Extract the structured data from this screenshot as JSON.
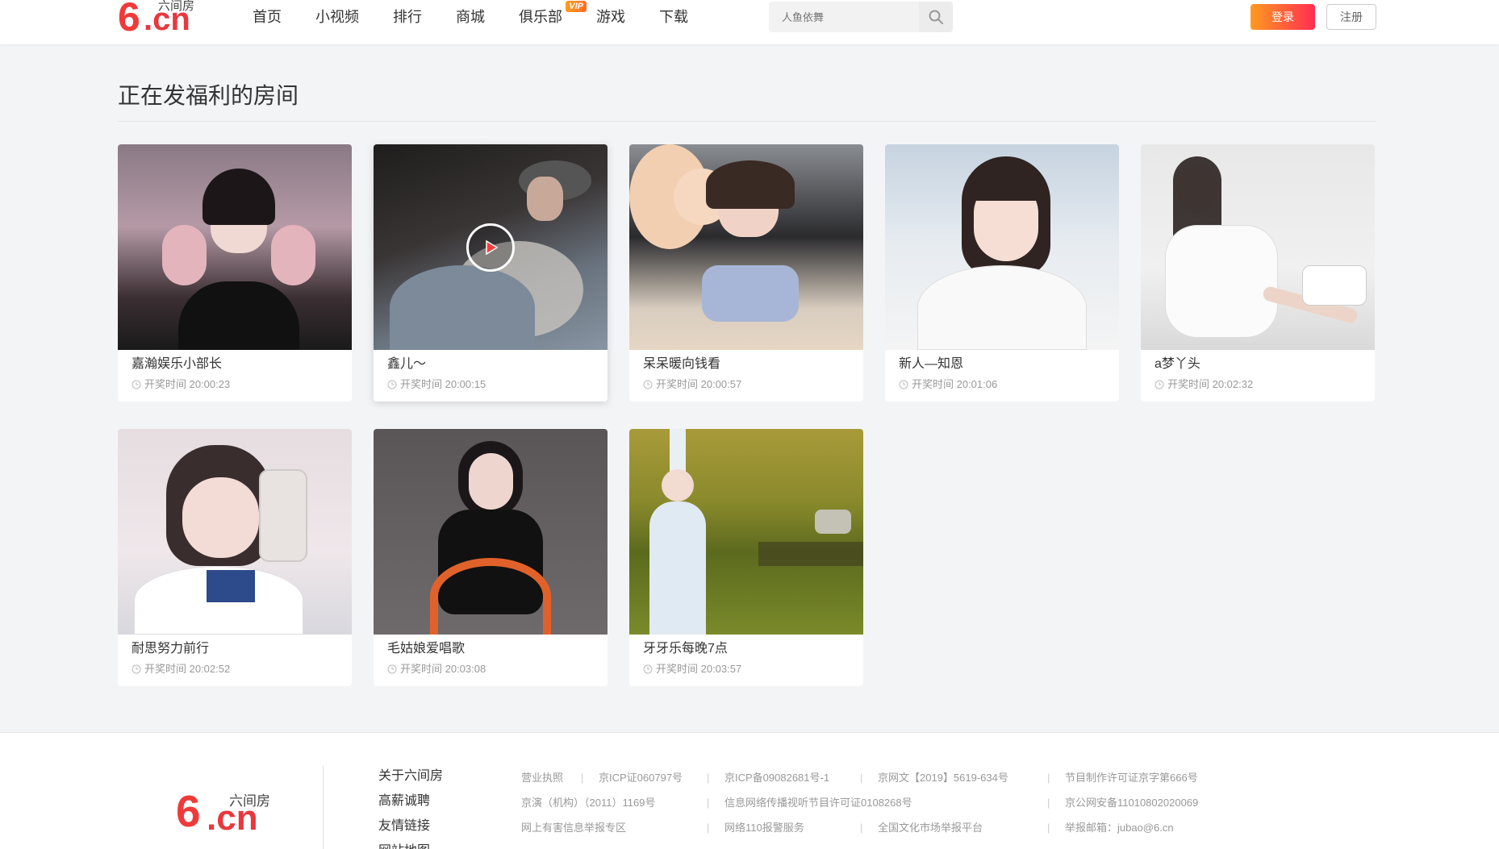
{
  "header": {
    "logo_text": "6.cn",
    "logo_six": "6",
    "logo_cn": ".cn",
    "logo_sub": "六间房",
    "nav": [
      "首页",
      "小视频",
      "排行",
      "商城",
      "俱乐部",
      "游戏",
      "下载"
    ],
    "vip_badge": "VIP",
    "search_placeholder": "人鱼依舞",
    "login": "登录",
    "register": "注册"
  },
  "section": {
    "title": "正在发福利的房间"
  },
  "time_prefix": "开奖时间",
  "rooms": [
    {
      "name": "嘉瀚娱乐小部长",
      "time": "开奖时间 20:00:23"
    },
    {
      "name": "鑫儿～",
      "time": "开奖时间 20:00:15"
    },
    {
      "name": "呆呆暖向钱看",
      "time": "开奖时间 20:00:57"
    },
    {
      "name": "新人—知恩",
      "time": "开奖时间 20:01:06"
    },
    {
      "name": "a梦丫头",
      "time": "开奖时间 20:02:32"
    },
    {
      "name": "耐思努力前行",
      "time": "开奖时间 20:02:52"
    },
    {
      "name": "毛姑娘爱唱歌",
      "time": "开奖时间 20:03:08"
    },
    {
      "name": "牙牙乐每晚7点",
      "time": "开奖时间 20:03:57"
    }
  ],
  "footer": {
    "logo_six": "6",
    "logo_cn": ".cn",
    "logo_sub": "六间房",
    "links": [
      "关于六间房",
      "高薪诚聘",
      "友情链接",
      "网站地图"
    ],
    "info": {
      "r1": [
        "营业执照",
        "京ICP证060797号",
        "京ICP备09082681号-1",
        "京网文【2019】5619-634号",
        "节目制作许可证京字第666号"
      ],
      "r2": [
        "京演（机构）（2011）1169号",
        "信息网络传播视听节目许可证0108268号",
        "京公网安备11010802020069"
      ],
      "r3": [
        "网上有害信息举报专区",
        "网络110报警服务",
        "全国文化市场举报平台",
        "举报邮箱：jubao@6.cn"
      ]
    }
  },
  "colors": {
    "accent_red": "#e8383d",
    "login_gradient_start": "#ff9a1f",
    "login_gradient_end": "#ff2d52",
    "vip_orange": "#ff8a1f"
  }
}
